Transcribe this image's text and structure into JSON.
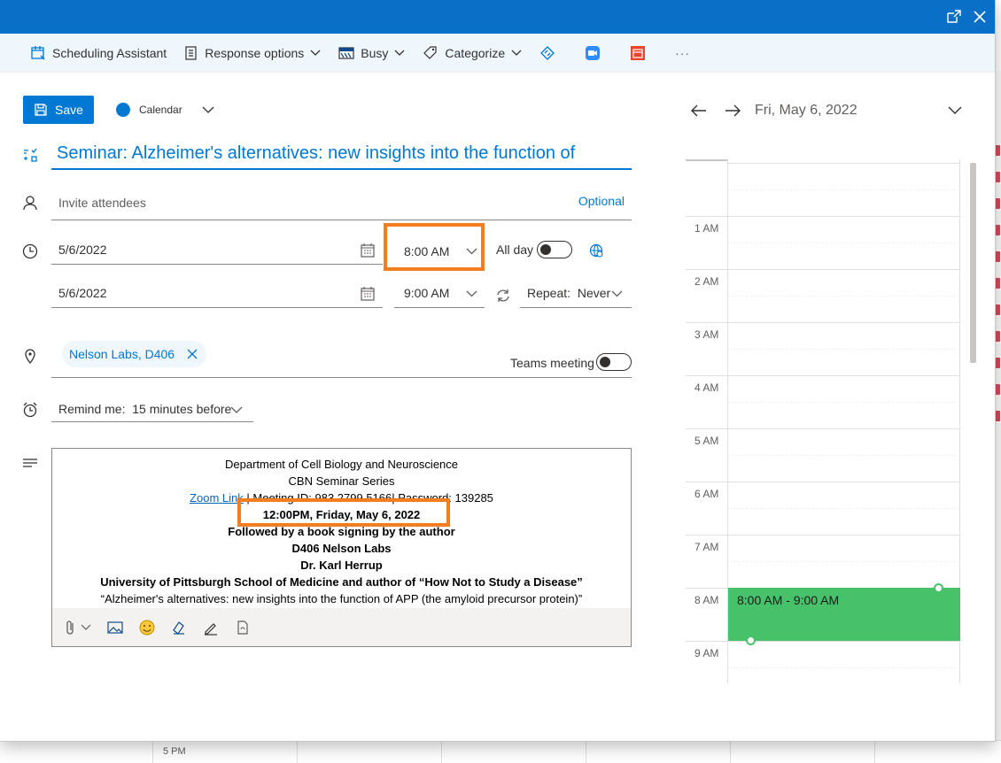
{
  "toolbar": {
    "scheduling_assistant": "Scheduling Assistant",
    "response_options": "Response options",
    "busy": "Busy",
    "categorize": "Categorize",
    "more": "···"
  },
  "form": {
    "save_label": "Save",
    "calendar_label": "Calendar",
    "title": "Seminar: Alzheimer's alternatives: new insights into the function of",
    "attendees_placeholder": "Invite attendees",
    "optional_label": "Optional",
    "start_date": "5/6/2022",
    "start_time": "8:00 AM",
    "all_day_label": "All day",
    "end_date": "5/6/2022",
    "end_time": "9:00 AM",
    "repeat_label": "Repeat:",
    "repeat_value": "Never",
    "location_chip": "Nelson Labs, D406",
    "teams_label": "Teams meeting",
    "remind_label": "Remind me:",
    "remind_value": "15 minutes before"
  },
  "body": {
    "line1": "Department of Cell Biology and Neuroscience",
    "line2": "CBN Seminar Series",
    "zoom_link": "Zoom Link",
    "meeting_info": " | Meeting ID: 983 2799 5166| Password: 139285",
    "date_line": "12:00PM, Friday, May 6, 2022",
    "line4": "Followed by a book signing by the author",
    "line5": "D406 Nelson Labs",
    "line6": "Dr. Karl Herrup",
    "line7": "University of Pittsburgh School of Medicine and author of “How Not to Study a Disease”",
    "line8": "“Alzheimer's alternatives: new insights into the function of APP (the amyloid precursor protein)”"
  },
  "day_view": {
    "date": "Fri, May 6, 2022",
    "hours": [
      "1 AM",
      "2 AM",
      "3 AM",
      "4 AM",
      "5 AM",
      "6 AM",
      "7 AM",
      "8 AM",
      "9 AM"
    ],
    "event_time": "8:00 AM - 9:00 AM"
  },
  "background": {
    "time_label": "5 PM"
  },
  "colors": {
    "accent": "#0078d4",
    "event_green": "#47c26b",
    "highlight_orange": "#f47d20"
  }
}
